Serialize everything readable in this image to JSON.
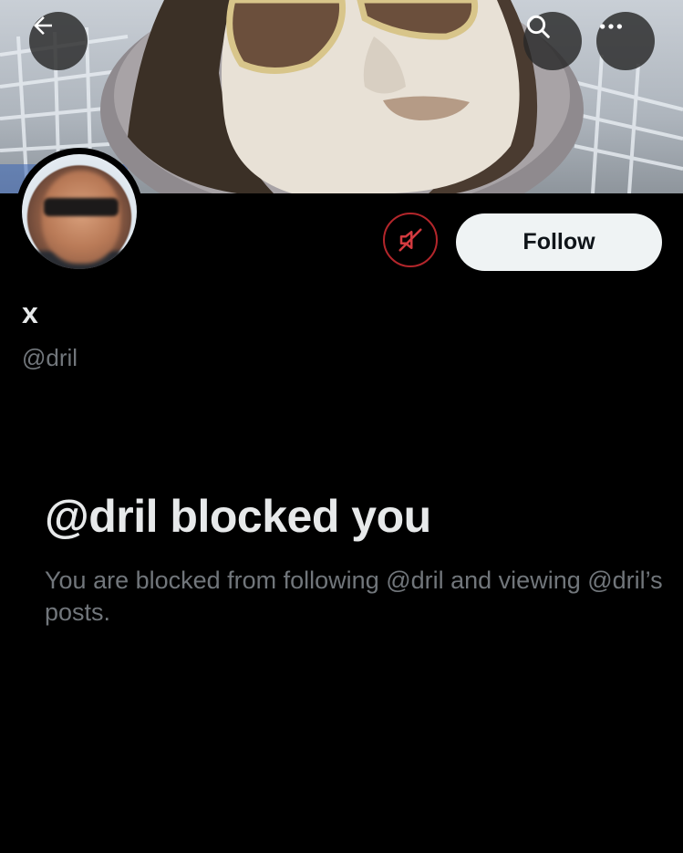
{
  "header": {
    "back_icon": "arrow-left-icon",
    "search_icon": "search-icon",
    "more_icon": "more-horizontal-icon"
  },
  "profile": {
    "display_name": "x",
    "handle": "@dril",
    "follow_label": "Follow",
    "mute_icon": "speaker-muted-icon",
    "accent_color": "#b3262b"
  },
  "blocked_notice": {
    "title": "@dril blocked you",
    "description": "You are blocked from following @dril and viewing @dril’s posts."
  }
}
